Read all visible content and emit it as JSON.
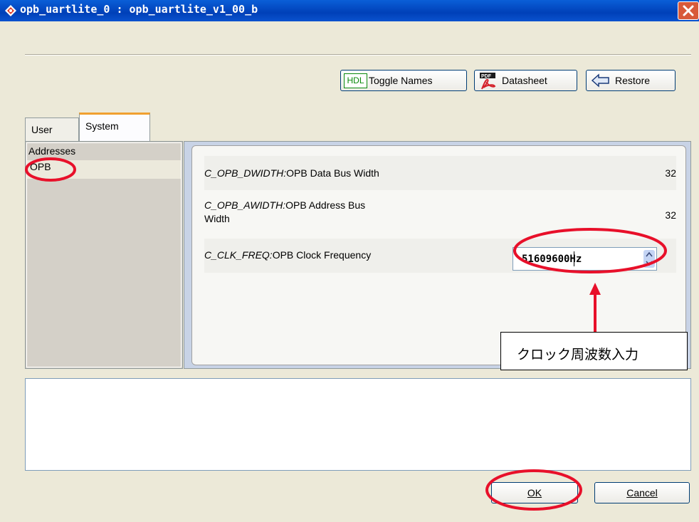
{
  "window": {
    "title": "opb_uartlite_0 : opb_uartlite_v1_00_b",
    "title_icon": "gear-diamond-icon",
    "close_icon": "close-icon"
  },
  "toolbar": {
    "hdl_badge": "HDL",
    "toggle_names_label": "Toggle Names",
    "datasheet_label": "Datasheet",
    "datasheet_icon": "pdf-icon",
    "restore_label": "Restore",
    "restore_icon": "restore-arrow-icon"
  },
  "tabs": [
    {
      "label": "User"
    },
    {
      "label": "System"
    }
  ],
  "categories": [
    {
      "label": "Addresses"
    },
    {
      "label": "OPB"
    }
  ],
  "params": [
    {
      "name": "C_OPB_DWIDTH:",
      "desc": "OPB Data Bus Width",
      "value": "32"
    },
    {
      "name": "C_OPB_AWIDTH:",
      "desc": "OPB Address Bus",
      "desc2": "Width",
      "value": "32"
    },
    {
      "name": "C_CLK_FREQ:",
      "desc": "OPB Clock Frequency",
      "value": "51609600Hz"
    }
  ],
  "annotation": {
    "callout_text": "クロック周波数入力",
    "highlight_color": "#e8102a"
  },
  "buttons": {
    "ok_label": "OK",
    "cancel_label": "Cancel"
  }
}
